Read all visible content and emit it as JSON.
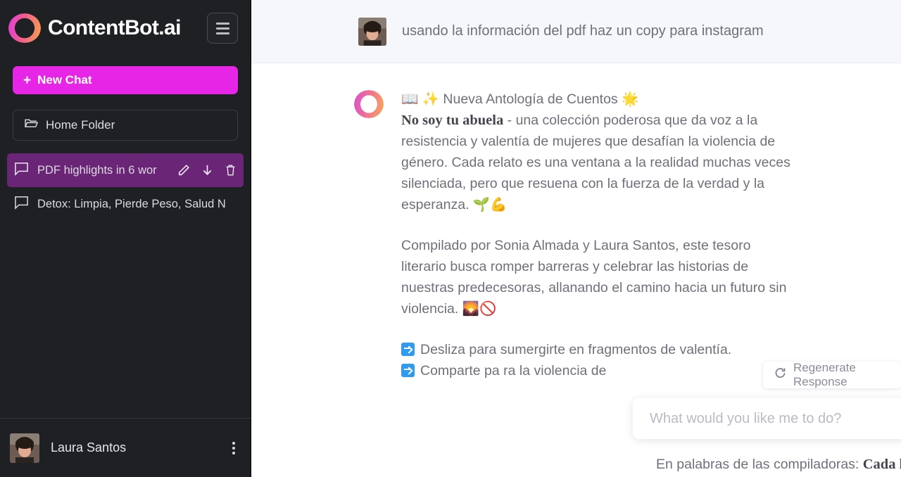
{
  "sidebar": {
    "brand": "ContentBot.ai",
    "menu_icon": "hamburger-icon",
    "new_chat_label": "New Chat",
    "new_chat_plus": "+",
    "folder_label": "Home Folder",
    "chats": [
      {
        "title": "PDF highlights in 6 wor",
        "active": true,
        "actions": [
          "pencil-icon",
          "download-icon",
          "trash-icon"
        ]
      },
      {
        "title": "Detox: Limpia, Pierde Peso, Salud N",
        "active": false,
        "actions": []
      }
    ],
    "user": {
      "name": "Laura Santos",
      "menu_icon": "kebab-menu-icon"
    },
    "colors": {
      "background": "#1f2023",
      "new_chat": "#e625e6",
      "active_chat": "#6b2577"
    }
  },
  "conversation": {
    "user_message": "usando la información del pdf haz un copy para instagram",
    "assistant": {
      "heading_emoji_left": "📖",
      "heading_emoji_sparkle": "✨",
      "heading": "Nueva Antología de Cuentos",
      "heading_emoji_right": "🌟",
      "p1_bold": "No soy tu abuela",
      "p1_rest": " - una colección poderosa que da voz a la resistencia y valentía de mujeres que desafían la violencia de género. Cada relato es una ventana a la realidad muchas veces silenciada, pero que resuena con la fuerza de la verdad y la esperanza. ",
      "p1_emoji": "🌱💪",
      "p2": "Compilado por Sonia Almada y Laura Santos, este tesoro literario busca romper barreras y celebrar las historias de nuestras predecesoras, allanando el camino hacia un futuro sin violencia. ",
      "p2_emoji": "🌄🚫",
      "bullets": [
        "Desliza para sumergirte en fragmentos de valentía.",
        "Comparte pa                              ra la violencia de"
      ],
      "tail_prefix": "En palabras de las compiladoras: ",
      "tail_bold": "Cada letra en estas"
    }
  },
  "regenerate": {
    "label": "Regenerate Response",
    "icon": "refresh-icon"
  },
  "composer": {
    "placeholder": "What would you like me to do?",
    "value": "",
    "inline_icons": [
      "book-icon",
      "send-icon"
    ],
    "external_icons": [
      "gear-icon",
      "file-upload-icon",
      "trash-icon"
    ],
    "upload_color": "#f03ce0"
  }
}
